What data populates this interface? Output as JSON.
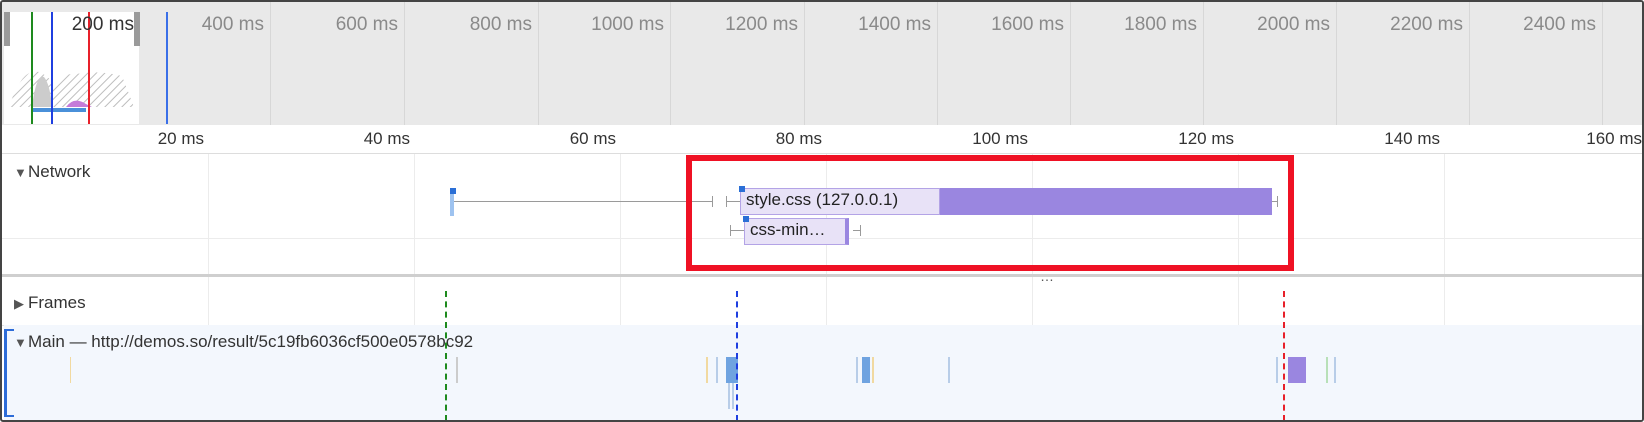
{
  "overview": {
    "labels": [
      "200 ms",
      "400 ms",
      "600 ms",
      "800 ms",
      "1000 ms",
      "1200 ms",
      "1400 ms",
      "1600 ms",
      "1800 ms",
      "2000 ms",
      "2200 ms",
      "2400 ms"
    ]
  },
  "ruler": {
    "labels": [
      "20 ms",
      "40 ms",
      "60 ms",
      "80 ms",
      "100 ms",
      "120 ms",
      "140 ms",
      "160 ms"
    ]
  },
  "tracks": {
    "network": {
      "title": "Network",
      "expanded": true
    },
    "frames": {
      "title": "Frames",
      "expanded": false
    },
    "main": {
      "title": "Main — http://demos.so/result/5c19fb6036cf500e0578bc92",
      "expanded": true
    }
  },
  "network_requests": [
    {
      "label": "style.css (127.0.0.1)"
    },
    {
      "label": "css-min…"
    }
  ],
  "divider": {
    "label": "…"
  },
  "colors": {
    "highlight": "#ef1124",
    "network_bar": "#9a86e0",
    "marker_green": "#1e8a1e",
    "marker_blue": "#1f3fe0",
    "marker_red": "#e8202a"
  }
}
